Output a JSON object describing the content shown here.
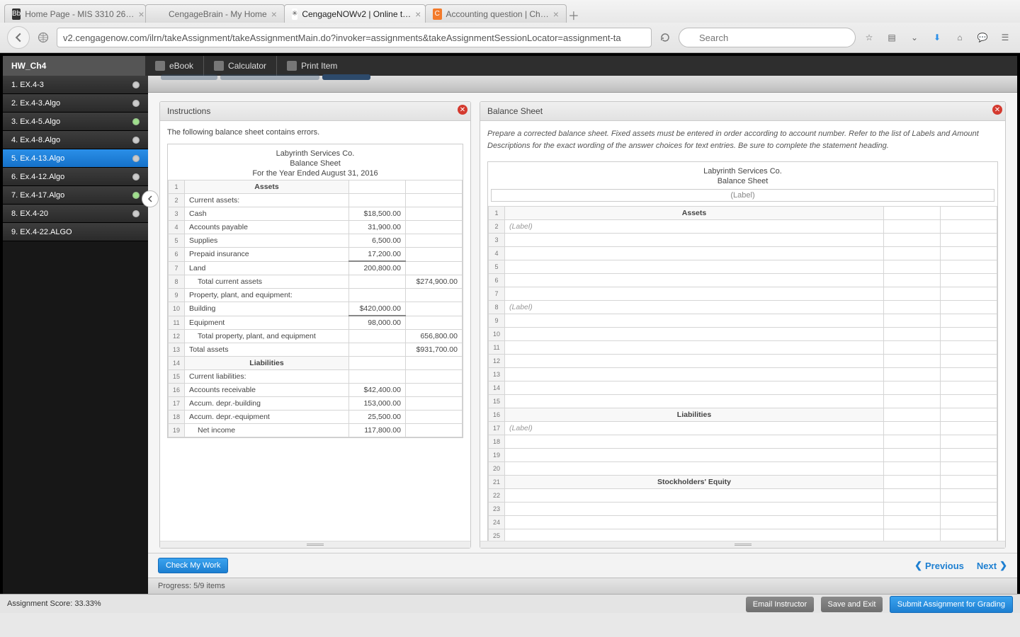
{
  "browser": {
    "tabs": [
      {
        "label": "Home Page - MIS 3310 26…",
        "favicon": "Bb",
        "favbg": "#333",
        "favcolor": "#fff"
      },
      {
        "label": "CengageBrain - My Home",
        "favicon": "",
        "favbg": "transparent"
      },
      {
        "label": "CengageNOWv2 | Online t…",
        "favicon": "✳",
        "favbg": "#fff",
        "active": true
      },
      {
        "label": "Accounting question | Ch…",
        "favicon": "C",
        "favbg": "#f37a2a",
        "favcolor": "#fff"
      }
    ],
    "url": "v2.cengagenow.com/ilrn/takeAssignment/takeAssignmentMain.do?invoker=assignments&takeAssignmentSessionLocator=assignment-ta",
    "search_placeholder": "Search"
  },
  "assignment": {
    "title": "HW_Ch4",
    "tools": [
      "eBook",
      "Calculator",
      "Print Item"
    ],
    "items": [
      {
        "label": "1. EX.4-3",
        "dot": "grey"
      },
      {
        "label": "2. Ex.4-3.Algo",
        "dot": "grey"
      },
      {
        "label": "3. Ex.4-5.Algo",
        "dot": "green"
      },
      {
        "label": "4. Ex.4-8.Algo",
        "dot": "grey"
      },
      {
        "label": "5. Ex.4-13.Algo",
        "dot": "grey",
        "active": true
      },
      {
        "label": "6. Ex.4-12.Algo",
        "dot": "grey"
      },
      {
        "label": "7. Ex.4-17.Algo",
        "dot": "green"
      },
      {
        "label": "8. EX.4-20",
        "dot": "grey"
      },
      {
        "label": "9. EX.4-22.ALGO",
        "dot": ""
      }
    ]
  },
  "instructions": {
    "title": "Instructions",
    "text": "The following balance sheet contains errors.",
    "company": "Labyrinth Services Co.",
    "stmt": "Balance Sheet",
    "period": "For the Year Ended August 31, 2016",
    "section_assets": "Assets",
    "section_liab": "Liabilities",
    "rows": [
      {
        "n": "2",
        "label": "Current assets:",
        "a": "",
        "b": ""
      },
      {
        "n": "3",
        "label": "Cash",
        "a": "$18,500.00",
        "b": ""
      },
      {
        "n": "4",
        "label": "Accounts payable",
        "a": "31,900.00",
        "b": ""
      },
      {
        "n": "5",
        "label": "Supplies",
        "a": "6,500.00",
        "b": ""
      },
      {
        "n": "6",
        "label": "Prepaid insurance",
        "a": "17,200.00",
        "b": ""
      },
      {
        "n": "7",
        "label": "Land",
        "a": "200,800.00",
        "b": "",
        "thick": true
      },
      {
        "n": "8",
        "label": "Total current assets",
        "a": "",
        "b": "$274,900.00",
        "indent": true
      },
      {
        "n": "9",
        "label": "Property, plant, and equipment:",
        "a": "",
        "b": ""
      },
      {
        "n": "10",
        "label": "Building",
        "a": "$420,000.00",
        "b": ""
      },
      {
        "n": "11",
        "label": "Equipment",
        "a": "98,000.00",
        "b": "",
        "thick": true
      },
      {
        "n": "12",
        "label": "Total property, plant, and equipment",
        "a": "",
        "b": "656,800.00",
        "indent": true
      },
      {
        "n": "13",
        "label": "Total assets",
        "a": "",
        "b": "$931,700.00"
      },
      {
        "n": "14",
        "label": "Liabilities",
        "hdr": true
      },
      {
        "n": "15",
        "label": "Current liabilities:",
        "a": "",
        "b": ""
      },
      {
        "n": "16",
        "label": "Accounts receivable",
        "a": "$42,400.00",
        "b": ""
      },
      {
        "n": "17",
        "label": "Accum. depr.-building",
        "a": "153,000.00",
        "b": ""
      },
      {
        "n": "18",
        "label": "Accum. depr.-equipment",
        "a": "25,500.00",
        "b": ""
      },
      {
        "n": "19",
        "label": "Net income",
        "a": "117,800.00",
        "b": "",
        "indent": true
      }
    ]
  },
  "worksheet": {
    "title": "Balance Sheet",
    "instruct": "Prepare a corrected balance sheet. Fixed assets must be entered in order according to account number. Refer to the list of Labels and Amount Descriptions for the exact wording of the answer choices for text entries. Be sure to complete the statement heading.",
    "company": "Labyrinth Services Co.",
    "stmt": "Balance Sheet",
    "date_placeholder": "(Label)",
    "label_placeholder": "(Label)",
    "section_assets": "Assets",
    "section_liab": "Liabilities",
    "section_equity": "Stockholders' Equity",
    "rows": 25
  },
  "footer": {
    "check": "Check My Work",
    "prev": "Previous",
    "next": "Next",
    "progress": "Progress: 5/9 items",
    "score": "Assignment Score: 33.33%",
    "email": "Email Instructor",
    "save": "Save and Exit",
    "submit": "Submit Assignment for Grading"
  }
}
